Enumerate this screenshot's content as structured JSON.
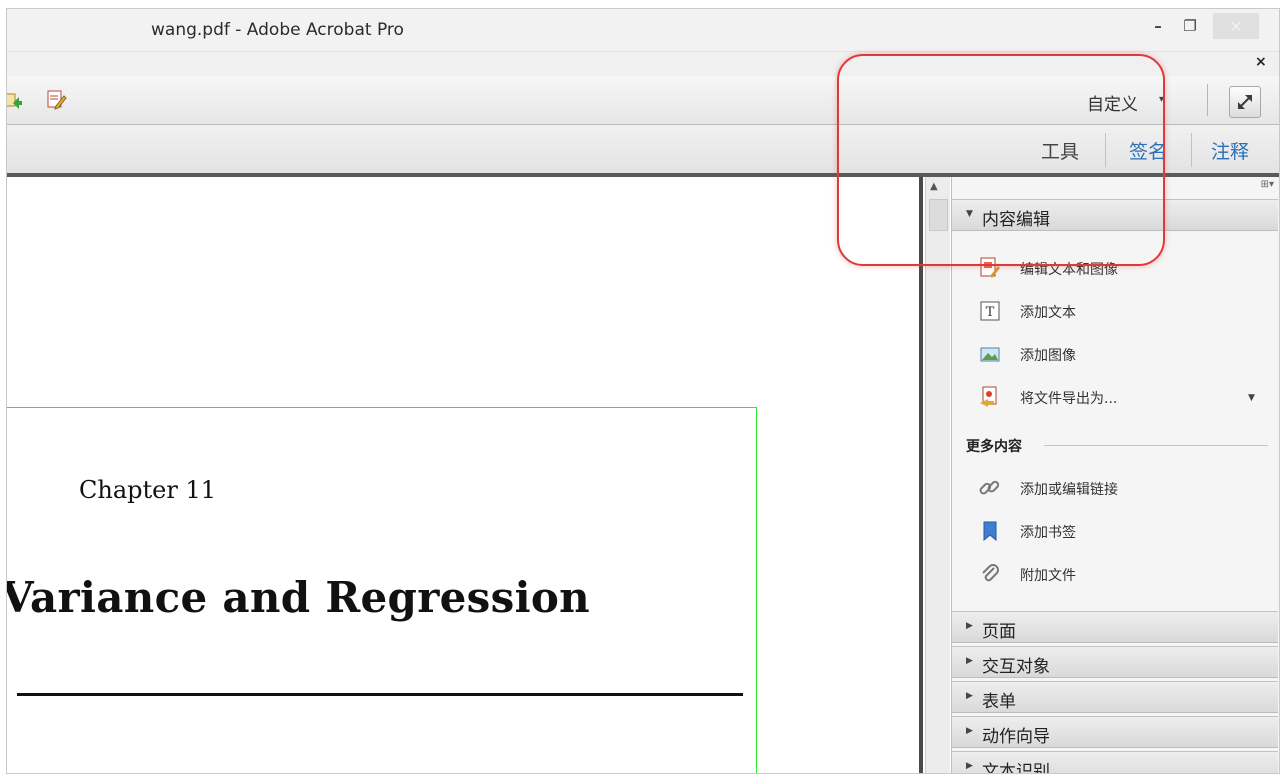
{
  "window": {
    "title": "wang.pdf - Adobe Acrobat Pro"
  },
  "window_controls": {
    "minimize": "–",
    "restore": "❐",
    "close": "×",
    "doc_close": "×"
  },
  "toolbar": {
    "customize_label": "自定义",
    "customize_caret": "▾"
  },
  "nav_tabs": [
    {
      "label": "工具",
      "color": "#444444"
    },
    {
      "label": "签名",
      "color": "#2a6fb8"
    },
    {
      "label": "注释",
      "color": "#2a6fb8"
    }
  ],
  "document": {
    "chapter": "Chapter 11",
    "heading": "Variance and Regression"
  },
  "panel": {
    "options_glyph": "⊞▾",
    "content_edit": {
      "title": "内容编辑",
      "tools": [
        {
          "label": "编辑文本和图像",
          "icon": "edit-text-image-icon"
        },
        {
          "label": "添加文本",
          "icon": "add-text-icon"
        },
        {
          "label": "添加图像",
          "icon": "add-image-icon"
        },
        {
          "label": "将文件导出为...",
          "icon": "export-file-icon"
        }
      ],
      "more_title": "更多内容",
      "more_tools": [
        {
          "label": "添加或编辑链接",
          "icon": "link-icon"
        },
        {
          "label": "添加书签",
          "icon": "bookmark-icon"
        },
        {
          "label": "附加文件",
          "icon": "paperclip-icon"
        }
      ]
    },
    "collapsed_sections": [
      "页面",
      "交互对象",
      "表单",
      "动作向导",
      "文本识别"
    ]
  },
  "colors": {
    "annotation": "#e0383b",
    "page_frame": "#2ee82e",
    "tab_accent": "#2a6fb8"
  }
}
